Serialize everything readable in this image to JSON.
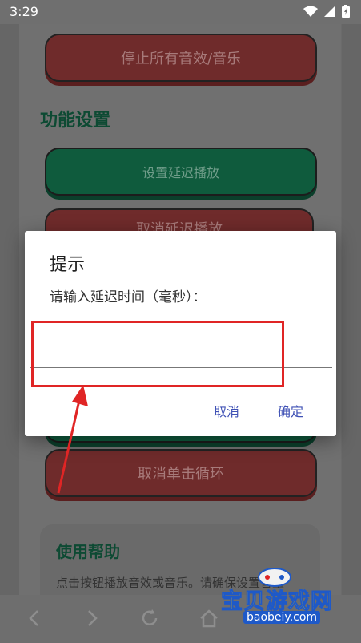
{
  "status_bar": {
    "time": "3:29",
    "icons": [
      "wifi-icon",
      "signal-icon",
      "battery-icon"
    ]
  },
  "main": {
    "stop_all_button": "停止所有音效/音乐",
    "section_title": "功能设置",
    "set_delay_button": "设置延迟播放",
    "cancel_delay_button": "取消延迟播放",
    "cancel_loop_button": "取消单击循环"
  },
  "help": {
    "title": "使用帮助",
    "text": "点击按钮播放音效或音乐。请确保设置音量"
  },
  "dialog": {
    "title": "提示",
    "message": "请输入延迟时间（毫秒）：",
    "input_value": "",
    "cancel_label": "取消",
    "confirm_label": "确定"
  },
  "watermark": {
    "main": "宝贝游戏网",
    "url": "baobeiy.com"
  },
  "colors": {
    "accent": "#3f51b5",
    "annotation": "#e02525",
    "green": "#0f5b3d",
    "red": "#6f2b2b"
  }
}
